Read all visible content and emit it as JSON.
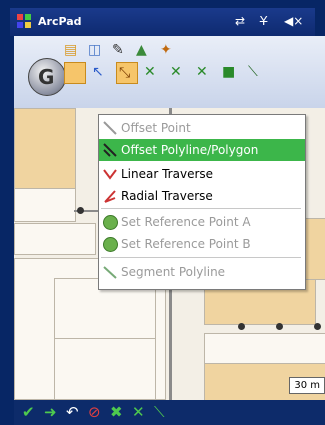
{
  "titlebar": {
    "app_name": "ArcPad",
    "status_icons": [
      "connectivity-icon",
      "signal-off-icon",
      "volume-mute-icon"
    ]
  },
  "toolbar": {
    "top_icons": [
      "folder-icon",
      "layer-icon",
      "edit-icon",
      "shapes-icon",
      "paint-icon"
    ],
    "row_icons": [
      "select-tool-icon",
      "pointer-icon",
      "offset-tool-icon",
      "vertex-icon",
      "snap-icon",
      "snap-icon-2",
      "polygon-icon",
      "polyline-icon"
    ],
    "active_tool": "offset-tool-icon"
  },
  "menu": {
    "items": [
      {
        "label": "Offset Point",
        "enabled": false,
        "highlighted": false,
        "icon": "offset-point-icon"
      },
      {
        "label": "Offset Polyline/Polygon",
        "enabled": true,
        "highlighted": true,
        "icon": "offset-polyline-icon"
      },
      {
        "label": "Linear Traverse",
        "enabled": true,
        "highlighted": false,
        "icon": "linear-traverse-icon"
      },
      {
        "label": "Radial Traverse",
        "enabled": true,
        "highlighted": false,
        "icon": "radial-traverse-icon"
      },
      {
        "label": "Set Reference Point A",
        "enabled": false,
        "highlighted": false,
        "icon": "reference-point-icon"
      },
      {
        "label": "Set Reference Point B",
        "enabled": false,
        "highlighted": false,
        "icon": "reference-point-icon"
      },
      {
        "label": "Segment Polyline",
        "enabled": false,
        "highlighted": false,
        "icon": "segment-polyline-icon"
      }
    ]
  },
  "map": {
    "scale_label": "30 m"
  },
  "bottombar": {
    "icons": [
      "check-icon",
      "forward-icon",
      "undo-icon",
      "cancel-icon",
      "close-icon",
      "vertex-icon",
      "snap-icon"
    ]
  },
  "colors": {
    "highlight": "#3cb64a",
    "parcel": "#f0d4a0",
    "frame": "#072665"
  }
}
